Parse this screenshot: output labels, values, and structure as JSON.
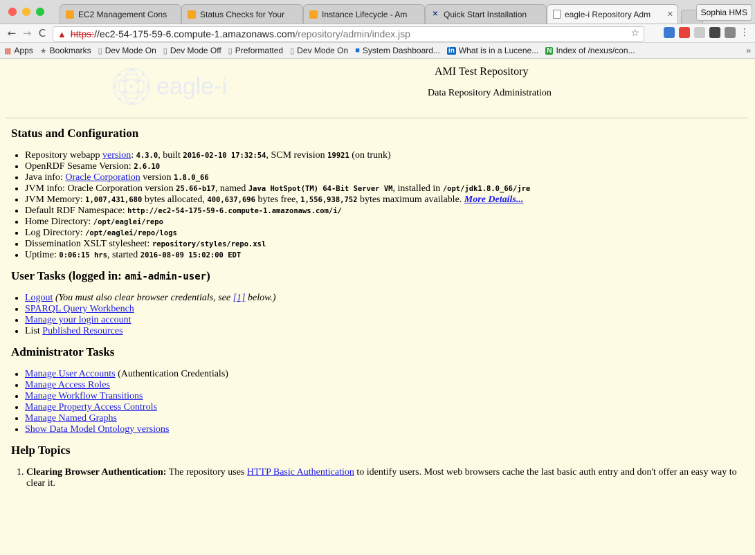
{
  "browser": {
    "tabs": [
      {
        "title": "EC2 Management Cons"
      },
      {
        "title": "Status Checks for Your"
      },
      {
        "title": "Instance Lifecycle - Am"
      },
      {
        "title": "Quick Start Installation"
      },
      {
        "title": "eagle-i Repository Adm"
      }
    ],
    "profile": "Sophia HMS",
    "url_scheme": "https:",
    "url_host": "//ec2-54-175-59-6.compute-1.amazonaws.com",
    "url_path": "/repository/admin/index.jsp",
    "bookmarks": [
      {
        "label": "Apps"
      },
      {
        "label": "Bookmarks"
      },
      {
        "label": "Dev Mode On"
      },
      {
        "label": "Dev Mode Off"
      },
      {
        "label": "Preformatted"
      },
      {
        "label": "Dev Mode On"
      },
      {
        "label": "System Dashboard..."
      },
      {
        "label": "What is in a Lucene..."
      },
      {
        "label": "Index of /nexus/con..."
      }
    ],
    "bookmarks_more": "»"
  },
  "header": {
    "logo_text": "eagle-i",
    "title": "AMI Test Repository",
    "subtitle": "Data Repository Administration"
  },
  "status": {
    "heading": "Status and Configuration",
    "webapp": {
      "p1": "Repository webapp ",
      "link": "version",
      "p2": ": ",
      "version": "4.3.0",
      "p3": ", built ",
      "built": "2016-02-10 17:32:54",
      "p4": ", SCM revision ",
      "rev": "19921",
      "p5": " (on trunk)"
    },
    "sesame": {
      "p1": "OpenRDF Sesame Version: ",
      "value": "2.6.10"
    },
    "java": {
      "p1": "Java info: ",
      "link": "Oracle Corporation",
      "p2": " version ",
      "value": "1.8.0_66"
    },
    "jvm": {
      "p1": "JVM info: Oracle Corporation version ",
      "version": "25.66-b17",
      "p2": ", named ",
      "name": "Java HotSpot(TM) 64-Bit Server VM",
      "p3": ", installed in ",
      "path": "/opt/jdk1.8.0_66/jre"
    },
    "memory": {
      "allocated": "1,007,431,680",
      "p1": "JVM Memory: ",
      "p2": " bytes allocated, ",
      "free": "400,637,696",
      "p3": " bytes free, ",
      "max": "1,556,938,752",
      "p4": " bytes maximum available. ",
      "link": "More Details..."
    },
    "namespace": {
      "p1": "Default RDF Namespace: ",
      "value": "http://ec2-54-175-59-6.compute-1.amazonaws.com/i/"
    },
    "home": {
      "p1": "Home Directory: ",
      "value": "/opt/eaglei/repo"
    },
    "log": {
      "p1": "Log Directory: ",
      "value": "/opt/eaglei/repo/logs"
    },
    "xslt": {
      "p1": "Dissemination XSLT stylesheet: ",
      "value": "repository/styles/repo.xsl"
    },
    "uptime": {
      "p1": "Uptime: ",
      "value": "0:06:15 hrs",
      "p2": ", started ",
      "started": "2016-08-09 15:02:00 EDT"
    }
  },
  "user_tasks": {
    "heading": "User Tasks (logged in: ",
    "user": "ami-admin-user",
    "heading_end": ")",
    "logout": "Logout",
    "logout_note_1": " (You must also clear browser credentials, see ",
    "logout_note_link": "[1]",
    "logout_note_2": " below.)",
    "sparql": "SPARQL Query Workbench",
    "manage_login": "Manage your login account",
    "list_prefix": "List ",
    "published": "Published Resources"
  },
  "admin_tasks": {
    "heading": "Administrator Tasks",
    "user_accounts": "Manage User Accounts",
    "user_accounts_note": " (Authentication Credentials)",
    "access_roles": "Manage Access Roles",
    "workflow": "Manage Workflow Transitions",
    "property": "Manage Property Access Controls",
    "named_graphs": "Manage Named Graphs",
    "ontology": "Show Data Model Ontology versions"
  },
  "help": {
    "heading": "Help Topics",
    "item1_title": "Clearing Browser Authentication:",
    "item1_p1": " The repository uses ",
    "item1_link": "HTTP Basic Authentication",
    "item1_p2": " to identify users. Most web browsers cache the last basic auth entry and don't offer an easy way to clear it."
  },
  "colors": {
    "page_bg": "#fdfbe3",
    "link": "#1a1ae6",
    "warn": "#c81e1e"
  }
}
